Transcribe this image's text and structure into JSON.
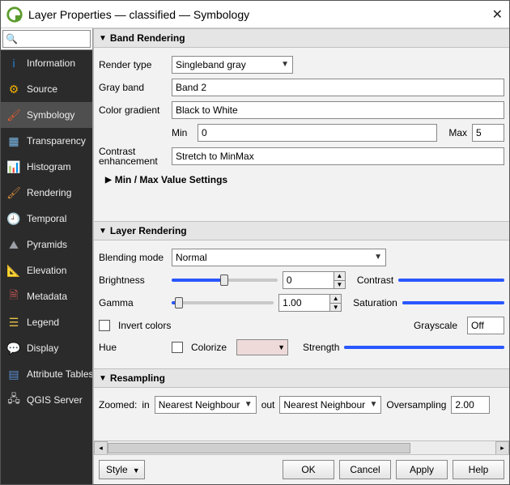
{
  "window": {
    "title": "Layer Properties — classified — Symbology"
  },
  "search": {
    "placeholder": ""
  },
  "sidebar": {
    "items": [
      {
        "label": "Information",
        "icon_color": "#2a82da",
        "glyph": "i"
      },
      {
        "label": "Source",
        "icon_color": "#f0b000",
        "glyph": "⚙"
      },
      {
        "label": "Symbology",
        "icon_color": "#e05a2b",
        "glyph": "🖌"
      },
      {
        "label": "Transparency",
        "icon_color": "#7ab8e6",
        "glyph": "▦"
      },
      {
        "label": "Histogram",
        "icon_color": "#6fa8dc",
        "glyph": "📊"
      },
      {
        "label": "Rendering",
        "icon_color": "#d08a3a",
        "glyph": "🖌"
      },
      {
        "label": "Temporal",
        "icon_color": "#cccccc",
        "glyph": "🕘"
      },
      {
        "label": "Pyramids",
        "icon_color": "#9aa0a6",
        "glyph": "⛰"
      },
      {
        "label": "Elevation",
        "icon_color": "#e8c84a",
        "glyph": "📐"
      },
      {
        "label": "Metadata",
        "icon_color": "#d35a5a",
        "glyph": "🗎"
      },
      {
        "label": "Legend",
        "icon_color": "#e6c24a",
        "glyph": "☰"
      },
      {
        "label": "Display",
        "icon_color": "#e6c24a",
        "glyph": "💬"
      },
      {
        "label": "Attribute Tables",
        "icon_color": "#5a8fd3",
        "glyph": "▤"
      },
      {
        "label": "QGIS Server",
        "icon_color": "#cccccc",
        "glyph": "🖧"
      }
    ],
    "selected_index": 2
  },
  "band_rendering": {
    "title": "Band Rendering",
    "render_type": {
      "label": "Render type",
      "value": "Singleband gray"
    },
    "gray_band": {
      "label": "Gray band",
      "value": "Band 2"
    },
    "color_gradient": {
      "label": "Color gradient",
      "value": "Black to White"
    },
    "min": {
      "label": "Min",
      "value": "0"
    },
    "max": {
      "label": "Max",
      "value": "5"
    },
    "contrast_enh": {
      "label": "Contrast enhancement",
      "value": "Stretch to MinMax"
    },
    "sub_expander": "Min / Max Value Settings"
  },
  "layer_rendering": {
    "title": "Layer Rendering",
    "blending_mode": {
      "label": "Blending mode",
      "value": "Normal"
    },
    "brightness": {
      "label": "Brightness",
      "value": "0",
      "percent": 50
    },
    "contrast": {
      "label": "Contrast"
    },
    "gamma": {
      "label": "Gamma",
      "value": "1.00",
      "percent": 7
    },
    "saturation": {
      "label": "Saturation"
    },
    "invert_colors": {
      "label": "Invert colors"
    },
    "grayscale": {
      "label": "Grayscale",
      "value": "Off"
    },
    "hue": {
      "label": "Hue"
    },
    "colorize": {
      "label": "Colorize"
    },
    "strength": {
      "label": "Strength",
      "percent": 100
    }
  },
  "resampling": {
    "title": "Resampling",
    "zoomed_label": "Zoomed:",
    "in_label": "in",
    "in_value": "Nearest Neighbour",
    "out_label": "out",
    "out_value": "Nearest Neighbour",
    "oversampling_label": "Oversampling",
    "oversampling_value": "2.00"
  },
  "footer": {
    "style": "Style",
    "ok": "OK",
    "cancel": "Cancel",
    "apply": "Apply",
    "help": "Help"
  }
}
